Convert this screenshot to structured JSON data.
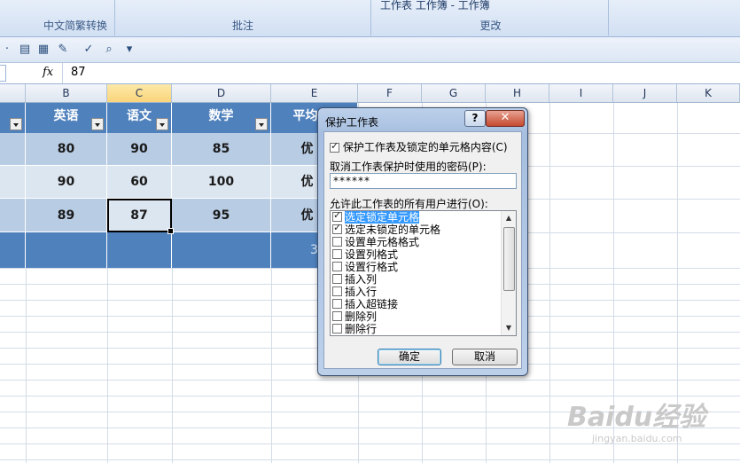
{
  "ribbon": {
    "group_chinese_conversion": "中文简繁转换",
    "group_comments": "批注",
    "group_changes": "更改",
    "changes_top_items": "工作表  工作簿 -  工作簿"
  },
  "formula_bar": {
    "fx_label": "fx",
    "value": "87"
  },
  "columns": [
    "B",
    "C",
    "D",
    "E",
    "F",
    "G",
    "H",
    "I",
    "J",
    "K"
  ],
  "table": {
    "headers": [
      "英语",
      "语文",
      "数学",
      "平均"
    ],
    "rows": [
      [
        "80",
        "90",
        "85",
        "优"
      ],
      [
        "90",
        "60",
        "100",
        "优"
      ],
      [
        "89",
        "87",
        "95",
        "优"
      ]
    ],
    "total_partial": "3"
  },
  "dialog": {
    "title": "保护工作表",
    "help_label": "?",
    "close_label": "✕",
    "protect_checkbox_label": "保护工作表及锁定的单元格内容(C)",
    "password_label": "取消工作表保护时使用的密码(P):",
    "password_value": "******",
    "allow_label": "允许此工作表的所有用户进行(O):",
    "permissions": [
      {
        "label": "选定锁定单元格",
        "checked": true
      },
      {
        "label": "选定未锁定的单元格",
        "checked": true
      },
      {
        "label": "设置单元格格式",
        "checked": false
      },
      {
        "label": "设置列格式",
        "checked": false
      },
      {
        "label": "设置行格式",
        "checked": false
      },
      {
        "label": "插入列",
        "checked": false
      },
      {
        "label": "插入行",
        "checked": false
      },
      {
        "label": "插入超链接",
        "checked": false
      },
      {
        "label": "删除列",
        "checked": false
      },
      {
        "label": "删除行",
        "checked": false
      }
    ],
    "ok_label": "确定",
    "cancel_label": "取消"
  },
  "watermark": {
    "brand": "Baidu经验",
    "url": "jingyan.baidu.com"
  },
  "colors": {
    "table_header": "#4f81bd",
    "row_light": "#b8cce4",
    "row_pale": "#dce6f1",
    "selection_highlight": "#3399ff"
  }
}
